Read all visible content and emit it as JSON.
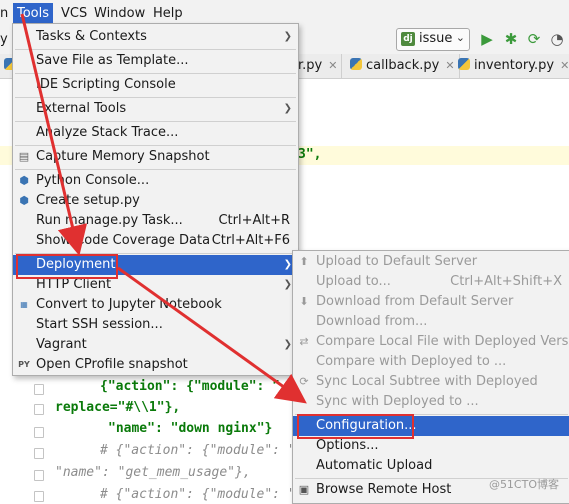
{
  "menubar": {
    "items": [
      "n",
      "Tools",
      "VCS",
      "Window",
      "Help"
    ]
  },
  "toolbar": {
    "left_fragment": "y",
    "run_config": "issue",
    "icons": [
      "play-icon",
      "bug-icon",
      "coverage-icon",
      "profile-icon"
    ]
  },
  "tabs": [
    "u",
    "er.py",
    "callback.py",
    "inventory.py"
  ],
  "tools_menu": {
    "items": [
      {
        "label": "Tasks & Contexts",
        "submenu": true
      },
      {
        "label": "Save File as Template..."
      },
      {
        "label": "IDE Scripting Console"
      },
      {
        "label": "External Tools",
        "submenu": true
      },
      {
        "label": "Analyze Stack Trace..."
      },
      {
        "label": "Capture Memory Snapshot"
      },
      {
        "label": "Python Console..."
      },
      {
        "label": "Create setup.py"
      },
      {
        "label": "Run manage.py Task...",
        "shortcut": "Ctrl+Alt+R"
      },
      {
        "label": "Show Code Coverage Data",
        "shortcut": "Ctrl+Alt+F6"
      },
      {
        "label": "Deployment",
        "submenu": true
      },
      {
        "label": "HTTP Client",
        "submenu": true
      },
      {
        "label": "Convert to Jupyter Notebook"
      },
      {
        "label": "Start SSH session..."
      },
      {
        "label": "Vagrant",
        "submenu": true
      },
      {
        "label": "Open CProfile snapshot"
      }
    ]
  },
  "deployment_menu": {
    "items": [
      {
        "label": "Upload to Default Server",
        "disabled": true
      },
      {
        "label": "Upload to...",
        "shortcut": "Ctrl+Alt+Shift+X",
        "disabled": true
      },
      {
        "label": "Download from Default Server",
        "disabled": true
      },
      {
        "label": "Download from...",
        "disabled": true
      },
      {
        "label": "Compare Local File with Deployed Version",
        "disabled": true
      },
      {
        "label": "Compare with Deployed to ...",
        "disabled": true
      },
      {
        "label": "Sync Local Subtree with Deployed",
        "disabled": true
      },
      {
        "label": "Sync with Deployed to ...",
        "disabled": true
      },
      {
        "label": "Configuration..."
      },
      {
        "label": "Options..."
      },
      {
        "label": "Automatic Upload"
      },
      {
        "label": "Browse Remote Host"
      }
    ]
  },
  "editor": {
    "lines": [
      "3\",",
      "{\"action\": {\"module\": \"",
      "replace=\"#\\\\1\"},",
      "\"name\": \"down nginx\"}",
      "# {\"action\": {\"module\": \"she",
      "\"name\": \"get_mem_usage\"},",
      "# {\"action\": {\"module\": \"she"
    ]
  },
  "watermark": "@51CTO博客",
  "colors": {
    "selection": "#2f65ca",
    "annotation": "#e03030",
    "menu_bg": "#f2f2f2"
  }
}
